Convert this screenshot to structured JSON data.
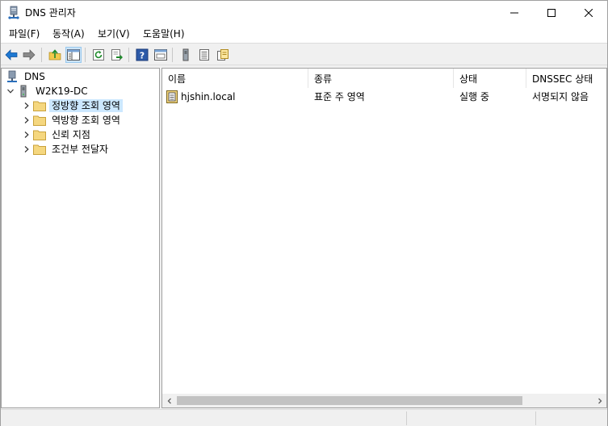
{
  "window": {
    "title": "DNS 관리자",
    "controls": [
      "minimize",
      "maximize",
      "close"
    ]
  },
  "menu": {
    "items": [
      {
        "label": "파일(F)"
      },
      {
        "label": "동작(A)"
      },
      {
        "label": "보기(V)"
      },
      {
        "label": "도움말(H)"
      }
    ]
  },
  "toolbar": {
    "buttons": [
      "back-icon",
      "forward-icon",
      "up-folder-icon",
      "show-hide-tree-icon",
      "refresh-icon",
      "export-list-icon",
      "help-icon",
      "console-view-icon",
      "server-icon",
      "list-view-icon",
      "properties-icon"
    ]
  },
  "tree": {
    "root": {
      "label": "DNS",
      "icon": "dns-icon"
    },
    "server": {
      "label": "W2K19-DC",
      "icon": "server-icon",
      "expanded": true
    },
    "children": [
      {
        "label": "정방향 조회 영역",
        "icon": "folder-icon",
        "selected": true
      },
      {
        "label": "역방향 조회 영역",
        "icon": "folder-icon",
        "selected": false
      },
      {
        "label": "신뢰 지점",
        "icon": "folder-icon",
        "selected": false
      },
      {
        "label": "조건부 전달자",
        "icon": "folder-icon",
        "selected": false
      }
    ]
  },
  "list": {
    "columns": [
      "이름",
      "종류",
      "상태",
      "DNSSEC 상태"
    ],
    "rows": [
      {
        "name": "hjshin.local",
        "type": "표준 주 영역",
        "status": "실행 중",
        "dnssec": "서명되지 않음",
        "icon": "zone-icon"
      }
    ]
  },
  "colors": {
    "selection": "#cce8ff",
    "toolbar_pressed": "#cce4f7",
    "window_bg": "#f0f0f0",
    "pane_bg": "#ffffff",
    "folder": "#f5d77f"
  }
}
